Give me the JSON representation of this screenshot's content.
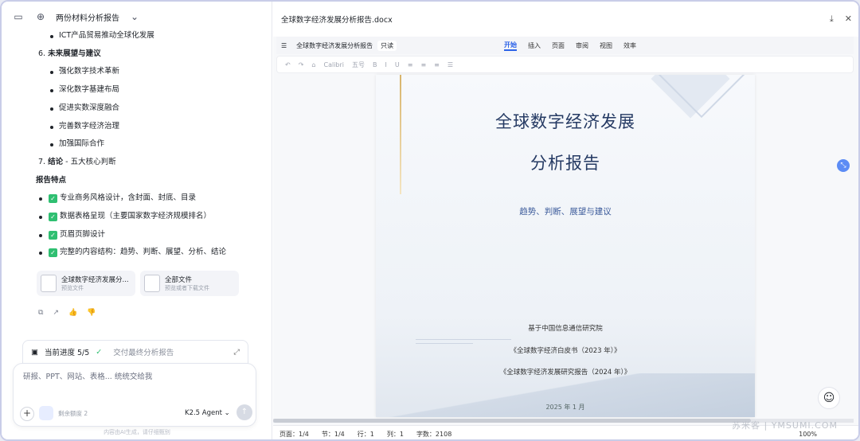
{
  "left": {
    "title": "两份材料分析报告",
    "lines": [
      {
        "kind": "li",
        "text": "ICT产品贸易推动全球化发展"
      },
      {
        "kind": "num",
        "num": "6.",
        "text": "未来展望与建议"
      },
      {
        "kind": "li",
        "text": "强化数字技术革新"
      },
      {
        "kind": "li",
        "text": "深化数字基建布局"
      },
      {
        "kind": "li",
        "text": "促进实数深度融合"
      },
      {
        "kind": "li",
        "text": "完善数字经济治理"
      },
      {
        "kind": "li",
        "text": "加强国际合作"
      },
      {
        "kind": "num2",
        "num": "7.",
        "bold": "结论",
        "rest": " - 五大核心判断"
      }
    ],
    "section_title": "报告特点",
    "features": [
      "专业商务风格设计，含封面、封底、目录",
      "数据表格呈现（主要国家数字经济规模排名）",
      "页眉页脚设计",
      "完整的内容结构：趋势、判断、展望、分析、结论"
    ],
    "files": [
      {
        "name": "全球数字经济发展分...",
        "sub": "预览文件"
      },
      {
        "name": "全部文件",
        "sub": "预览或者下载文件"
      }
    ],
    "progress": {
      "label": "当前进度 5/5",
      "done": "交付最终分析报告"
    },
    "input_placeholder": "研报、PPT、网站、表格... 统统交给我",
    "quota": "剩余额度 2",
    "agent": "K2.5 Agent",
    "footer": "内容由AI生成，请仔细甄别"
  },
  "doc": {
    "filename": "全球数字经济发展分析报告.docx",
    "menu_name": "全球数字经济发展分析报告",
    "readonly": "只读",
    "tabs": [
      "开始",
      "插入",
      "页面",
      "审阅",
      "视图",
      "效率"
    ],
    "toolbar": [
      "Calibri",
      "五号"
    ],
    "title1": "全球数字经济发展",
    "title2": "分析报告",
    "subtitle": "趋势、判断、展望与建议",
    "source1": "基于中国信息通信研究院",
    "source2": "《全球数字经济白皮书（2023 年）》",
    "source3": "《全球数字经济发展研究报告（2024 年）》",
    "date": "2025 年 1 月",
    "status": {
      "page": "页面：1/4",
      "section": "节：1/4",
      "row": "行：1",
      "col": "列：1",
      "words": "字数：2108",
      "zoom": "100%"
    },
    "watermark": "苏米客 | YMSUMI.COM"
  }
}
